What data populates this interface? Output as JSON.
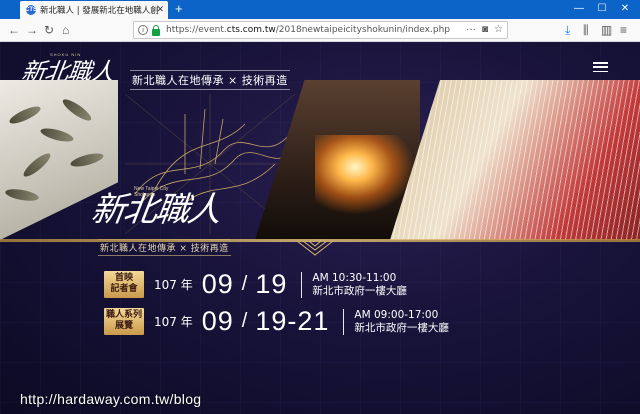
{
  "browser": {
    "tab_title": "新北職人 | 發展新北在地職人創",
    "tab_favicon": "CTS",
    "url_prefix": "https://event.",
    "url_host": "cts.com.tw",
    "url_path": "/2018newtaipeicityshokunin/index.php"
  },
  "header": {
    "logo_text": "新北職人",
    "logo_en": "SHOKU NIN",
    "tagline": "新北職人在地傳承 × 技術再造"
  },
  "hero": {
    "logo_text": "新北職人",
    "logo_en": "New Taipei City Shokunin",
    "subtitle": "新北職人在地傳承 × 技術再造"
  },
  "events": [
    {
      "badge_line1": "首映",
      "badge_line2": "記者會",
      "year": "107 年",
      "month": "09",
      "day": "19",
      "time": "AM 10:30-11:00",
      "location": "新北市政府一樓大廳"
    },
    {
      "badge_line1": "職人系列",
      "badge_line2": "展覽",
      "year": "107 年",
      "month": "09",
      "day": "19-21",
      "time": "AM 09:00-17:00",
      "location": "新北市政府一樓大廳"
    }
  ],
  "watermark": "http://hardaway.com.tw/blog",
  "icons": [
    "back-icon",
    "forward-icon",
    "reload-icon",
    "home-icon",
    "info-icon",
    "lock-icon",
    "menu-icon"
  ],
  "colors": {
    "tab_bar": "#0d64c8",
    "page_bg": "#18133a",
    "gold": "#d9b56a"
  }
}
